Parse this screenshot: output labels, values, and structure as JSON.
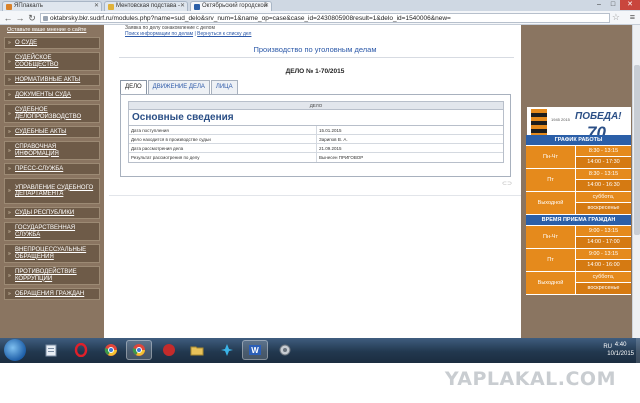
{
  "browser": {
    "tabs": [
      {
        "label": "ЯПлакалъ",
        "active": false
      },
      {
        "label": "Ментовская подстава - ",
        "active": false
      },
      {
        "label": "Октябрьский городской ",
        "active": true
      }
    ],
    "url": "oktabrsky.bkr.sudrf.ru/modules.php?name=sud_delo&srv_num=1&name_op=case&case_id=2430805908result=1&delo_id=1540006&new="
  },
  "sidebar": {
    "top_link": "Оставьте ваше мнение о сайте",
    "items": [
      "О СУДЕ",
      "СУДЕЙСКОЕ СООБЩЕСТВО",
      "НОРМАТИВНЫЕ АКТЫ",
      "ДОКУМЕНТЫ СУДА",
      "СУДЕБНОЕ ДЕЛОПРОИЗВОДСТВО",
      "СУДЕБНЫЕ АКТЫ",
      "СПРАВОЧНАЯ ИНФОРМАЦИЯ",
      "ПРЕСС-СЛУЖБА",
      "УПРАВЛЕНИЕ СУДЕБНОГО ДЕПАРТАМЕНТА",
      "СУДЫ РЕСПУБЛИКИ",
      "ГОСУДАРСТВЕННАЯ СЛУЖБА",
      "ВНЕПРОЦЕССУАЛЬНЫЕ ОБРАЩЕНИЯ",
      "ПРОТИВОДЕЙСТВИЕ КОРРУПЦИИ",
      "ОБРАЩЕНИЯ ГРАЖДАН"
    ]
  },
  "main": {
    "top_line": "Заявка по делу ознакомление с делом",
    "top_links": [
      "Поиск информации по делам",
      "Вернуться к списку дел"
    ],
    "section_title": "Производство по уголовным делам",
    "case_number": "ДЕЛО № 1-70/2015",
    "tabs": [
      "ДЕЛО",
      "ДВИЖЕНИЕ ДЕЛА",
      "ЛИЦА"
    ],
    "table_header": "ДЕЛО",
    "table_heading": "Основные сведения",
    "rows": [
      {
        "label": "Дата поступления",
        "value": "15.01.2015"
      },
      {
        "label": "Дело находится в производстве судьи",
        "value": "Зарипов В. А."
      },
      {
        "label": "Дата рассмотрения дела",
        "value": "21.09.2015"
      },
      {
        "label": "Результат рассмотрения по делу",
        "value": "Вынесен ПРИГОВОР"
      }
    ]
  },
  "promo": {
    "title": "ПОБЕДА!",
    "subtitle": "70 ЛЕТ",
    "years": "1945 2015"
  },
  "schedule": {
    "work_title": "ГРАФИК РАБОТЫ",
    "work": [
      {
        "day": "Пн-Чт",
        "times": [
          "8:30 - 13:15",
          "14:00 - 17:30"
        ]
      },
      {
        "day": "Пт",
        "times": [
          "8:30 - 13:15",
          "14:00 - 16:30"
        ]
      },
      {
        "day": "Выходной",
        "times": [
          "суббота,",
          "воскресенье"
        ]
      }
    ],
    "reception_title": "ВРЕМЯ ПРИЕМА ГРАЖДАН",
    "reception": [
      {
        "day": "Пн-Чт",
        "times": [
          "9:00 - 13:15",
          "14:00 - 17:00"
        ]
      },
      {
        "day": "Пт",
        "times": [
          "9:00 - 13:15",
          "14:00 - 16:00"
        ]
      },
      {
        "day": "Выходной",
        "times": [
          "суббота,",
          "воскресенье"
        ]
      }
    ]
  },
  "taskbar": {
    "lang": "RU",
    "time": "4:40",
    "date": "10/1/2015"
  },
  "watermark": "YAPLAKAL.COM"
}
